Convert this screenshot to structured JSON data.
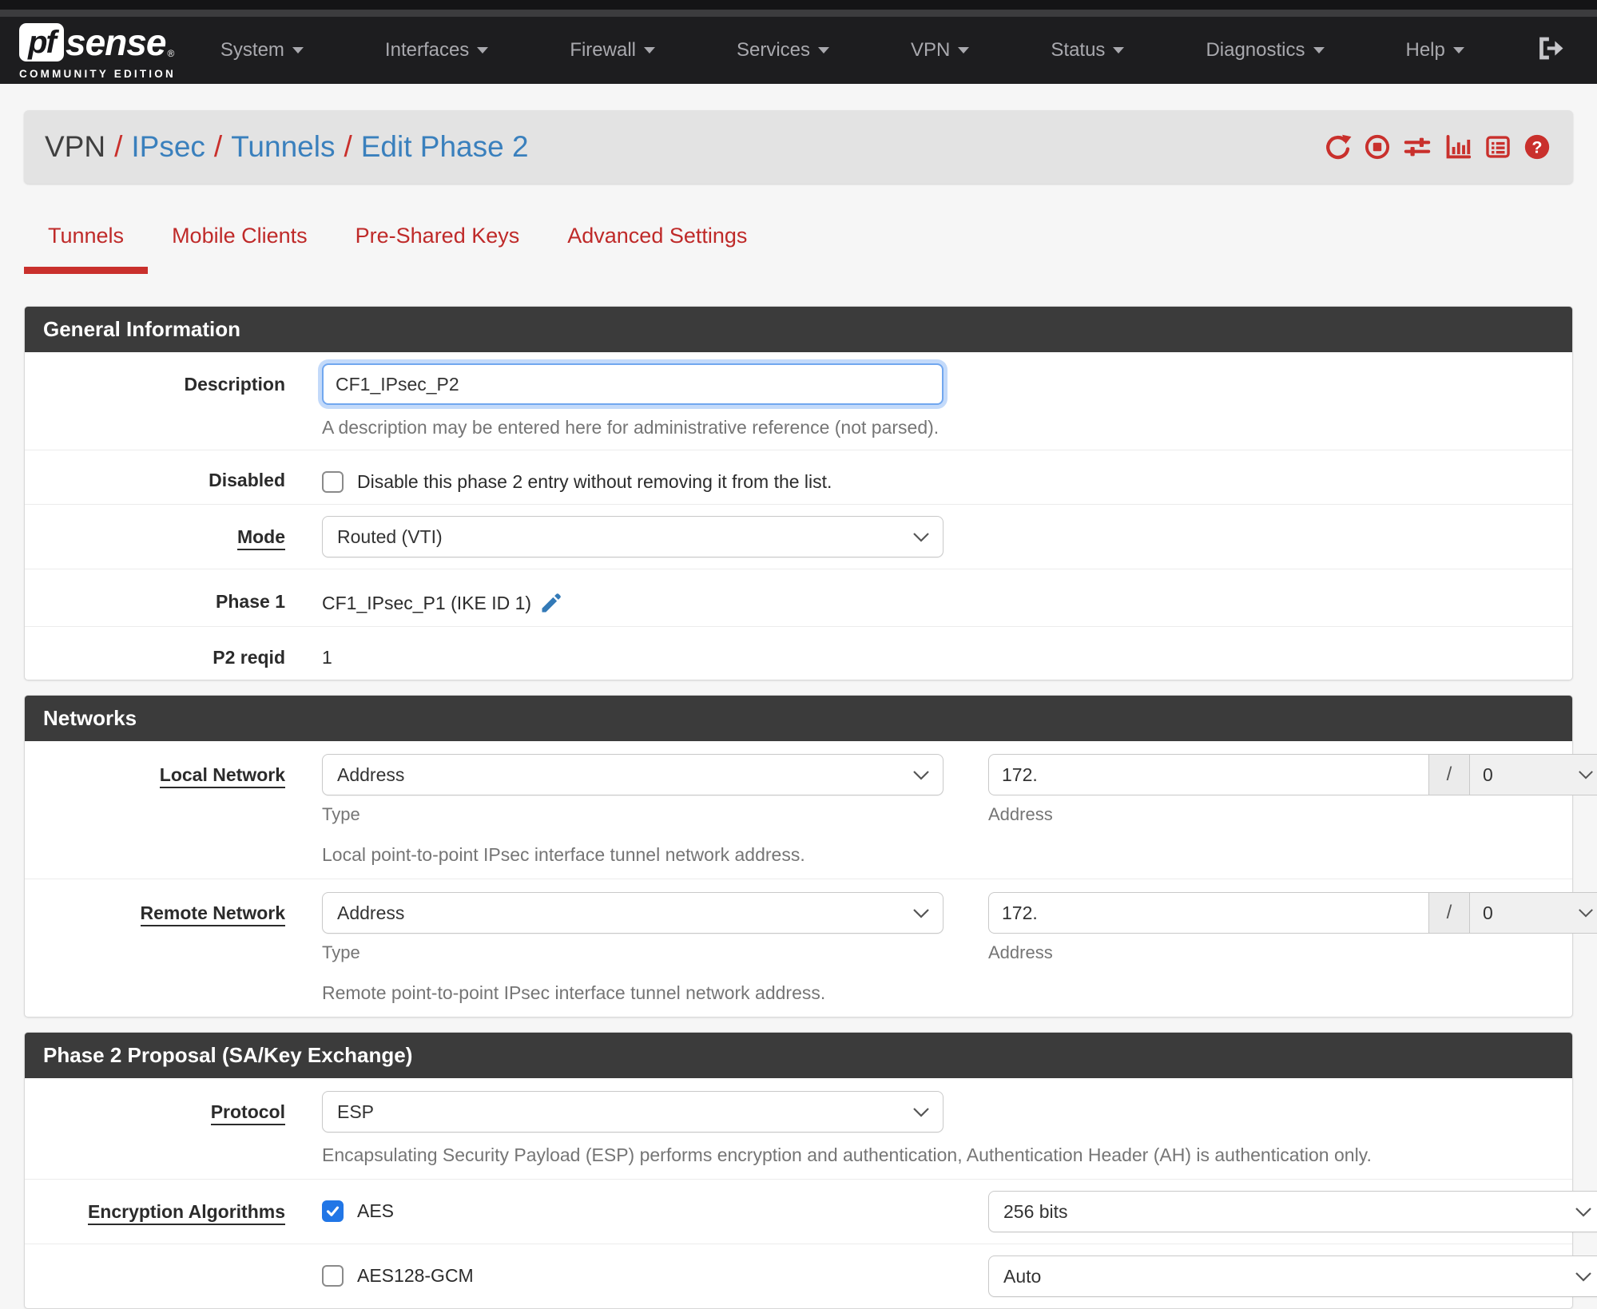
{
  "colors": {
    "accent_red": "#c9302c",
    "link_blue": "#3a80bd",
    "panel_header_bg": "#3b3b3b",
    "checkbox_blue": "#2176e6",
    "navbar_bg": "#1d1d1f",
    "breadcrumb_bg": "#e3e3e3"
  },
  "navbar": {
    "logo": {
      "pf": "pf",
      "sense": "sense",
      "registered": "®",
      "tagline": "COMMUNITY EDITION"
    },
    "items": [
      {
        "label": "System"
      },
      {
        "label": "Interfaces"
      },
      {
        "label": "Firewall"
      },
      {
        "label": "Services"
      },
      {
        "label": "VPN"
      },
      {
        "label": "Status"
      },
      {
        "label": "Diagnostics"
      },
      {
        "label": "Help"
      }
    ]
  },
  "breadcrumb": {
    "separator": "/",
    "items": [
      {
        "label": "VPN"
      },
      {
        "label": "IPsec"
      },
      {
        "label": "Tunnels"
      },
      {
        "label": "Edit Phase 2"
      }
    ],
    "icons": [
      "refresh-icon",
      "stop-circle-icon",
      "sliders-icon",
      "bar-chart-icon",
      "list-icon",
      "help-icon"
    ]
  },
  "tabs": [
    {
      "label": "Tunnels",
      "active": true
    },
    {
      "label": "Mobile Clients",
      "active": false
    },
    {
      "label": "Pre-Shared Keys",
      "active": false
    },
    {
      "label": "Advanced Settings",
      "active": false
    }
  ],
  "general": {
    "title": "General Information",
    "description_label": "Description",
    "description_value": "CF1_IPsec_P2",
    "description_help": "A description may be entered here for administrative reference (not parsed).",
    "disabled_label": "Disabled",
    "disabled_checkbox_label": "Disable this phase 2 entry without removing it from the list.",
    "disabled_checked": false,
    "mode_label": "Mode",
    "mode_value": "Routed (VTI)",
    "phase1_label": "Phase 1",
    "phase1_value": "CF1_IPsec_P1 (IKE ID 1)",
    "p2reqid_label": "P2 reqid",
    "p2reqid_value": "1"
  },
  "networks": {
    "title": "Networks",
    "local": {
      "label": "Local Network",
      "type_value": "Address",
      "type_caption": "Type",
      "address_value": "172.",
      "address_caption": "Address",
      "slash": "/",
      "prefix_value": "0",
      "help": "Local point-to-point IPsec interface tunnel network address."
    },
    "remote": {
      "label": "Remote Network",
      "type_value": "Address",
      "type_caption": "Type",
      "address_value": "172.",
      "address_caption": "Address",
      "slash": "/",
      "prefix_value": "0",
      "help": "Remote point-to-point IPsec interface tunnel network address."
    }
  },
  "proposal": {
    "title": "Phase 2 Proposal (SA/Key Exchange)",
    "protocol_label": "Protocol",
    "protocol_value": "ESP",
    "protocol_help": "Encapsulating Security Payload (ESP) performs encryption and authentication, Authentication Header (AH) is authentication only.",
    "encryption_label": "Encryption Algorithms",
    "algorithms": [
      {
        "name": "AES",
        "checked": true,
        "keylen": "256 bits"
      },
      {
        "name": "AES128-GCM",
        "checked": false,
        "keylen": "Auto"
      }
    ]
  }
}
